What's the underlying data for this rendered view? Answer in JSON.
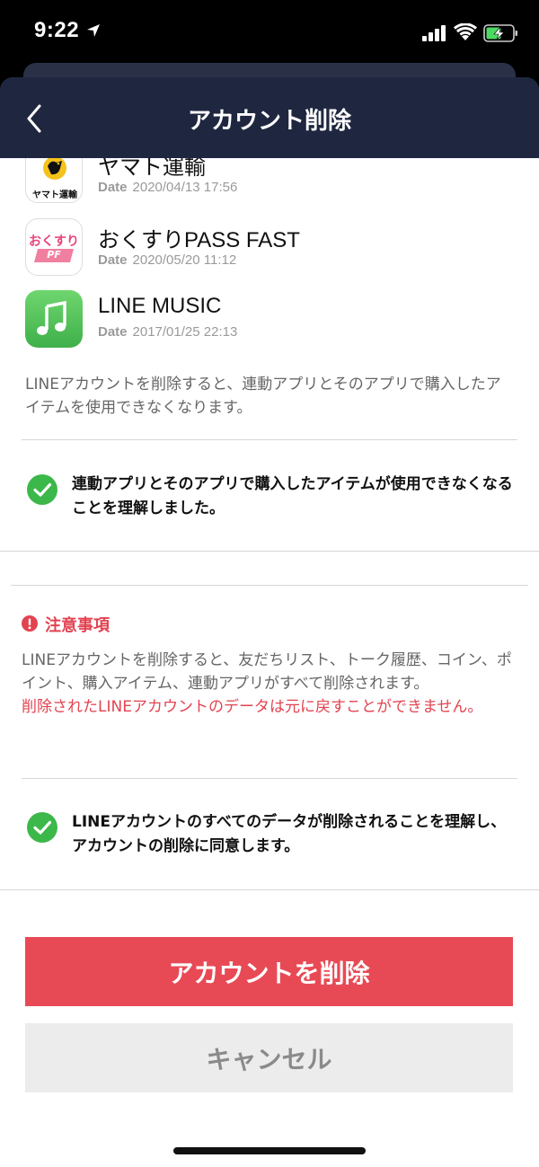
{
  "status_bar": {
    "time": "9:22"
  },
  "header": {
    "title": "アカウント削除"
  },
  "apps": [
    {
      "name": "ヤマト運輸",
      "date_label": "Date",
      "date": "2020/04/13 17:56",
      "icon": "yamato-icon",
      "icon_text": "ヤマト運輸"
    },
    {
      "name": "おくすりPASS FAST",
      "date_label": "Date",
      "date": "2020/05/20 11:12",
      "icon": "okusuri-icon",
      "icon_text": "おくすり",
      "icon_badge": "PF"
    },
    {
      "name": "LINE MUSIC",
      "date_label": "Date",
      "date": "2017/01/25 22:13",
      "icon": "music-note-icon"
    }
  ],
  "apps_notice": "LINEアカウントを削除すると、連動アプリとそのアプリで購入したアイテムを使用できなくなります。",
  "check1": {
    "text": "連動アプリとそのアプリで購入したアイテムが使用できなくなることを理解しました。",
    "checked": true
  },
  "notice": {
    "title": "注意事項",
    "body": "LINEアカウントを削除すると、友だちリスト、トーク履歴、コイン、ポイント、購入アイテム、連動アプリがすべて削除されます。",
    "warning": "削除されたLINEアカウントのデータは元に戻すことができません。"
  },
  "check2": {
    "text": "LINEアカウントのすべてのデータが削除されることを理解し、アカウントの削除に同意します。",
    "checked": true
  },
  "buttons": {
    "delete": "アカウントを削除",
    "cancel": "キャンセル"
  },
  "colors": {
    "accent_red": "#e84a55",
    "check_green": "#3cb84a",
    "navbar": "#1f2740"
  }
}
